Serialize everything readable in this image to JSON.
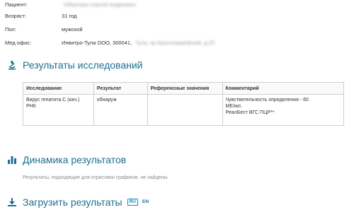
{
  "patient": {
    "patient_label": "Пациент:",
    "patient_value": "Обертман Сергей Андреевич",
    "age_label": "Возраст:",
    "age_value": "31 год",
    "sex_label": "Пол:",
    "sex_value": "мужской",
    "office_label": "Мед офис:",
    "office_value": "Инвитро-Тула ООО, 300041,",
    "office_address": "Тула, пр.Красноармейский, д.25"
  },
  "results_section": {
    "title": "Результаты исследований",
    "columns": [
      "Исследование",
      "Результат",
      "Референсные значения",
      "Комментарий"
    ],
    "rows": [
      {
        "test_line1": "Вирус гепатита С (кач.)",
        "test_line2": "РНК",
        "result": "обнаруж",
        "reference": "",
        "comment_line1": "Чувствительность определения - 60",
        "comment_line2": "МЕ/мл.",
        "comment_line3": "РеалБест ВГС ПЦР**"
      }
    ]
  },
  "dynamics_section": {
    "title": "Динамика результатов",
    "empty_message": "Результаты, подходящие для отрисовки графиков, не найдены"
  },
  "download_section": {
    "title": "Загрузить результаты",
    "lang_ru": "RU",
    "lang_en": "EN"
  },
  "colors": {
    "accent": "#1d6f8f",
    "link": "#0b8fbf",
    "border": "#cfcfcf"
  },
  "icons": {
    "results": "microscope-icon",
    "dynamics": "bar-chart-icon",
    "download": "download-icon"
  }
}
